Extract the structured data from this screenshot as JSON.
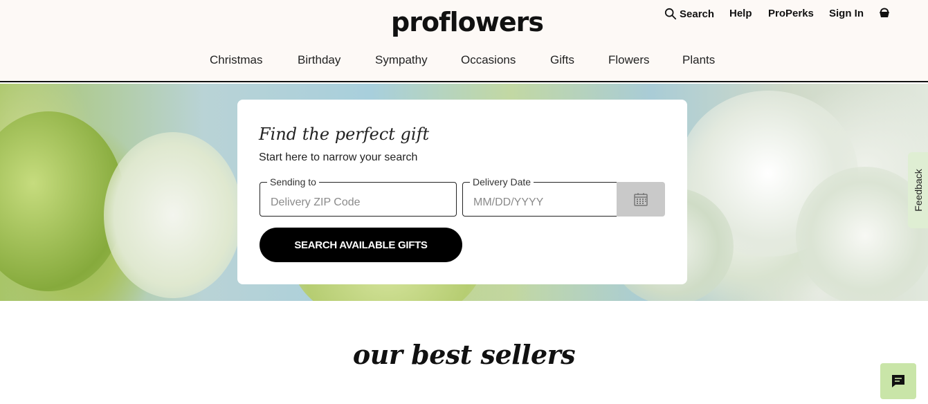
{
  "header": {
    "logo": "proflowers",
    "util": {
      "search_label": "Search",
      "help_label": "Help",
      "properks_label": "ProPerks",
      "signin_label": "Sign In",
      "cart_icon": "basket-icon"
    },
    "nav": [
      "Christmas",
      "Birthday",
      "Sympathy",
      "Occasions",
      "Gifts",
      "Flowers",
      "Plants"
    ]
  },
  "search_card": {
    "title": "Find the perfect gift",
    "subtitle": "Start here to narrow your search",
    "zip_label": "Sending to",
    "zip_placeholder": "Delivery ZIP Code",
    "date_label": "Delivery Date",
    "date_placeholder": "MM/DD/YYYY",
    "calendar_icon": "calendar-icon",
    "button_label": "SEARCH AVAILABLE GIFTS"
  },
  "feedback": {
    "label": "Feedback"
  },
  "best_sellers": {
    "title": "our best sellers"
  },
  "chat": {
    "icon": "chat-icon"
  },
  "colors": {
    "header_bg": "#fdf9f6",
    "button_bg": "#000000",
    "calendar_bg": "#c9c9c9",
    "feedback_bg": "#dfeed3",
    "chat_bg": "#c9e5a8"
  }
}
